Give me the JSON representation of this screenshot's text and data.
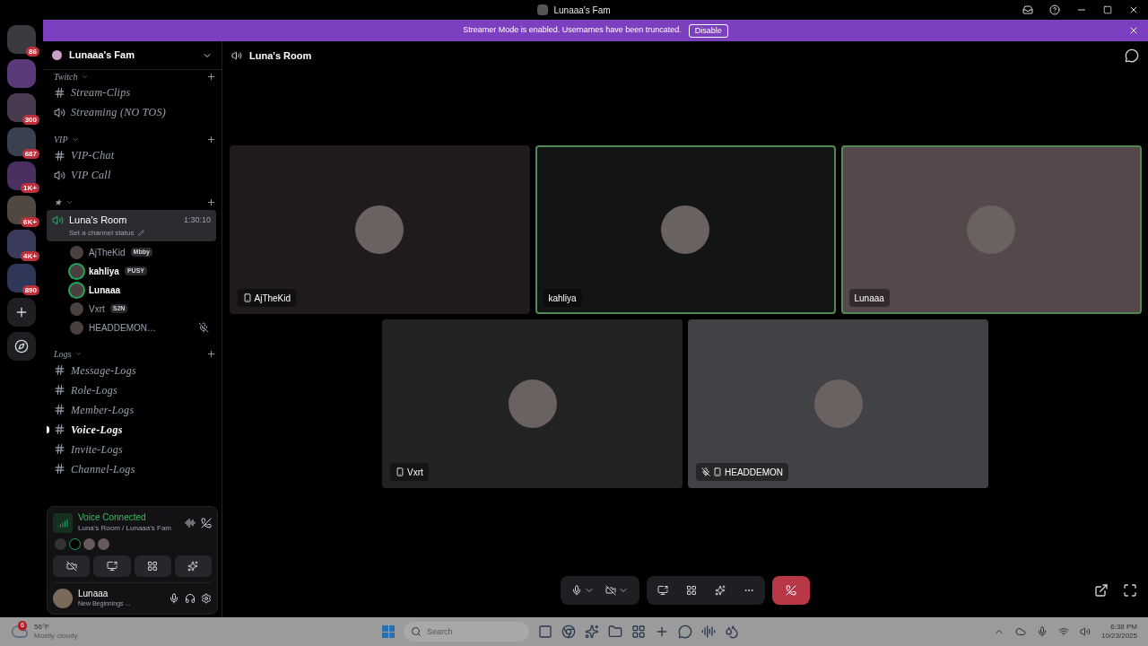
{
  "window": {
    "title": "Lunaaa's Fam"
  },
  "banner": {
    "text": "Streamer Mode is enabled. Usernames have been truncated.",
    "button": "Disable"
  },
  "servers": [
    {
      "badge": "86",
      "color": "#3a3a40"
    },
    {
      "color": "#5b3a7a"
    },
    {
      "badge": "300",
      "color": "#4a3a50"
    },
    {
      "badge": "687",
      "color": "#3a4050"
    },
    {
      "badge": "1K+",
      "color": "#4a3060"
    },
    {
      "badge": "6K+",
      "color": "#504840"
    },
    {
      "badge": "4K+",
      "color": "#3a3a5a"
    },
    {
      "badge": "890",
      "color": "#30385a"
    }
  ],
  "server_name": "Lunaaa's Fam",
  "categories": [
    {
      "name": "Twitch",
      "channels": [
        {
          "kind": "text",
          "name": "Stream-Clips"
        },
        {
          "kind": "voice",
          "name": "Streaming (NO TOS)"
        }
      ]
    },
    {
      "name": "VIP",
      "channels": [
        {
          "kind": "text",
          "name": "VIP-Chat"
        },
        {
          "kind": "voice",
          "name": "VIP Call"
        }
      ]
    },
    {
      "name": "★",
      "channels": [
        {
          "kind": "voice",
          "name": "Luna's Room",
          "selected": true,
          "timer": "1:30:10",
          "status": "Set a channel status",
          "members": [
            {
              "name": "AjTheKid",
              "tag": "Mbby",
              "speaking": false,
              "muted": false
            },
            {
              "name": "kahliya",
              "tag": "PUSY",
              "speaking": true,
              "muted": false
            },
            {
              "name": "Lunaaa",
              "speaking": true,
              "muted": false
            },
            {
              "name": "Vxrt",
              "tag": "S2N",
              "speaking": false,
              "muted": false
            },
            {
              "name": "HEADDEMON…",
              "speaking": false,
              "muted": true
            }
          ]
        }
      ]
    },
    {
      "name": "Logs",
      "channels": [
        {
          "kind": "text",
          "name": "Message-Logs"
        },
        {
          "kind": "text",
          "name": "Role-Logs"
        },
        {
          "kind": "text",
          "name": "Member-Logs"
        },
        {
          "kind": "text",
          "name": "Voice-Logs",
          "unread": true
        },
        {
          "kind": "text",
          "name": "Invite-Logs"
        },
        {
          "kind": "text",
          "name": "Channel-Logs"
        }
      ]
    }
  ],
  "voice_panel": {
    "status": "Voice Connected",
    "location": "Luna's Room / Lunaaa's Fam"
  },
  "user": {
    "name": "Lunaaa",
    "activity": "New Beginnings ..."
  },
  "room": {
    "title": "Luna's Room"
  },
  "tiles": [
    {
      "name": "AjTheKid",
      "mobile": true,
      "speaking": false,
      "muted": false,
      "color": "#1e1a1d"
    },
    {
      "name": "kahliya",
      "mobile": false,
      "speaking": true,
      "muted": false,
      "color": "#141414"
    },
    {
      "name": "Lunaaa",
      "mobile": false,
      "speaking": true,
      "muted": false,
      "color": "#56474a"
    },
    {
      "name": "Vxrt",
      "mobile": true,
      "speaking": false,
      "muted": false,
      "color": "#222222"
    },
    {
      "name": "HEADDEMON",
      "mobile": true,
      "speaking": false,
      "muted": true,
      "color": "#424146"
    }
  ],
  "taskbar": {
    "weather_badge": "6",
    "temperature": "56°F",
    "weather": "Mostly cloudy",
    "search_placeholder": "Search",
    "time": "6:38 PM",
    "date": "10/23/2025"
  }
}
